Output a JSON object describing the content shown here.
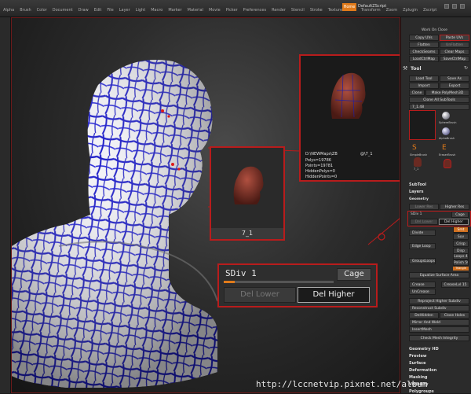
{
  "menubar": {
    "items": [
      "Alpha",
      "Brush",
      "Color",
      "Document",
      "Draw",
      "Edit",
      "File",
      "Layer",
      "Light",
      "Macro",
      "Marker",
      "Material",
      "Movie",
      "Picker",
      "Preferences",
      "Render",
      "Stencil",
      "Stroke",
      "Texture",
      "Tool",
      "Transform",
      "Zoom",
      "Zplugin",
      "Zscript"
    ],
    "home_label": "Home",
    "script_label": "DefaultZScript"
  },
  "right_panel": {
    "top_header": "Work On Close",
    "uv_buttons": [
      {
        "label": "Copy UVs"
      },
      {
        "label": "Paste UVs"
      },
      {
        "label": "Flatten"
      },
      {
        "label": "UnFlatten"
      },
      {
        "label": "CheckSeams"
      },
      {
        "label": "Clear Maps"
      },
      {
        "label": "LoadCtrlMap"
      },
      {
        "label": "SaveCtrlMap"
      }
    ],
    "tool_title": "Tool",
    "tool_buttons": [
      {
        "label": "Load Tool"
      },
      {
        "label": "Save As"
      },
      {
        "label": "Import"
      },
      {
        "label": "Export"
      },
      {
        "label": "Clone"
      },
      {
        "label": "Make PolyMesh3D"
      },
      {
        "label": "Clone All SubTools"
      }
    ],
    "tool_name": "7_1.48",
    "brushes": [
      {
        "label": "SphereBrush"
      },
      {
        "label": "AlphaBrush"
      },
      {
        "label": "SimpleBrush"
      },
      {
        "label": "EraserBrush"
      },
      {
        "label": "7_1"
      }
    ],
    "sections_a": [
      "SubTool",
      "Layers",
      "Geometry"
    ],
    "geometry": {
      "lower_res": "Lower Res",
      "higher_res": "Higher Res",
      "sdiv": "SDiv 1",
      "cage": "Cage",
      "del_lower": "Del Lower",
      "del_higher": "Del Higher",
      "divide": "Divide",
      "smt": "Smt",
      "suv": "Suv",
      "edge_loop": "Edge Loop",
      "crisp": "Crisp",
      "disp": "Disp",
      "group_loops": "GroupsLoops",
      "loops": "Loops 4",
      "polish": "Polish 50",
      "triangle": "Triangle",
      "equalize": "Equalize Surface Area",
      "crease": "Crease",
      "crease_lvl": "CreaseLvl 15",
      "uncrease": "UnCrease",
      "reproject": "Reproject Higher Subdiv",
      "reconstruct": "Reconstruct Subdiv",
      "deladd": "DelHidden",
      "close_holes": "Close Holes",
      "mirror_weld": "Mirror And Weld",
      "insert_mesh": "InsertMesh",
      "check_mesh": "Check Mesh Integrity"
    },
    "sections_b": [
      "Geometry HD",
      "Preview",
      "Surface",
      "Deformation",
      "Masking",
      "Visibility",
      "Polygroups"
    ]
  },
  "info_popup": {
    "path": "D:\\NEWMaps\\ZB",
    "name_short": "@\\7_1",
    "polys": "Polys=19786",
    "points": "Points=19781",
    "hidden_polys": "HiddenPolys=0",
    "hidden_points": "HiddenPoints=0"
  },
  "thumb_popup": {
    "label": "7_1"
  },
  "subdiv_zoom": {
    "sdiv": "SDiv 1",
    "cage": "Cage",
    "del_lower": "Del Lower",
    "del_higher": "Del Higher",
    "sdiv_level": 0.1
  },
  "watermark": "http://lccnetvip.pixnet.net/album",
  "colors": {
    "accent": "#e07a1a",
    "highlight_border": "#b81c1c",
    "uv_line": "#1a1ac8",
    "mesh_red": "#8c3a2c"
  }
}
